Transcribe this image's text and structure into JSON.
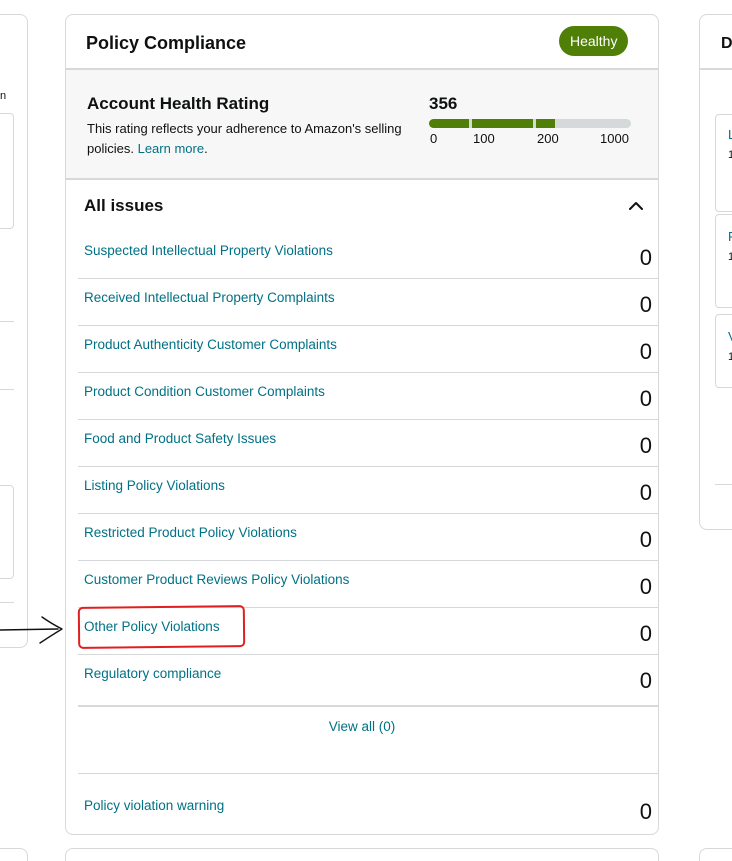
{
  "left_fragment": {
    "text": "n"
  },
  "right_fragment": {
    "title": "D",
    "items": [
      "L",
      "1",
      "F",
      "1",
      "V",
      "1"
    ]
  },
  "card": {
    "title": "Policy Compliance",
    "badge": "Healthy",
    "colors": {
      "badge": "#507f08",
      "link": "#007185",
      "bar_fill": "#507f08",
      "bar_track": "#d5d9d9"
    }
  },
  "ahr": {
    "title": "Account Health Rating",
    "desc": "This rating reflects your adherence to Amazon's selling policies.",
    "learn_more": "Learn more",
    "score": "356",
    "score_value": 356,
    "ticks": [
      "0",
      "100",
      "200",
      "1000"
    ]
  },
  "issues": {
    "title": "All issues",
    "rows": [
      {
        "label": "Suspected Intellectual Property Violations",
        "count": "0"
      },
      {
        "label": "Received Intellectual Property Complaints",
        "count": "0"
      },
      {
        "label": "Product Authenticity Customer Complaints",
        "count": "0"
      },
      {
        "label": "Product Condition Customer Complaints",
        "count": "0"
      },
      {
        "label": "Food and Product Safety Issues",
        "count": "0"
      },
      {
        "label": "Listing Policy Violations",
        "count": "0"
      },
      {
        "label": "Restricted Product Policy Violations",
        "count": "0"
      },
      {
        "label": "Customer Product Reviews Policy Violations",
        "count": "0"
      },
      {
        "label": "Other Policy Violations",
        "count": "0"
      },
      {
        "label": "Regulatory compliance",
        "count": "0"
      }
    ],
    "view_all": "View all (0)"
  },
  "warning": {
    "label": "Policy violation warning",
    "count": "0"
  },
  "annotations": {
    "highlight_color": "#e02020",
    "icon": "hand-drawn-arrow-icon"
  }
}
